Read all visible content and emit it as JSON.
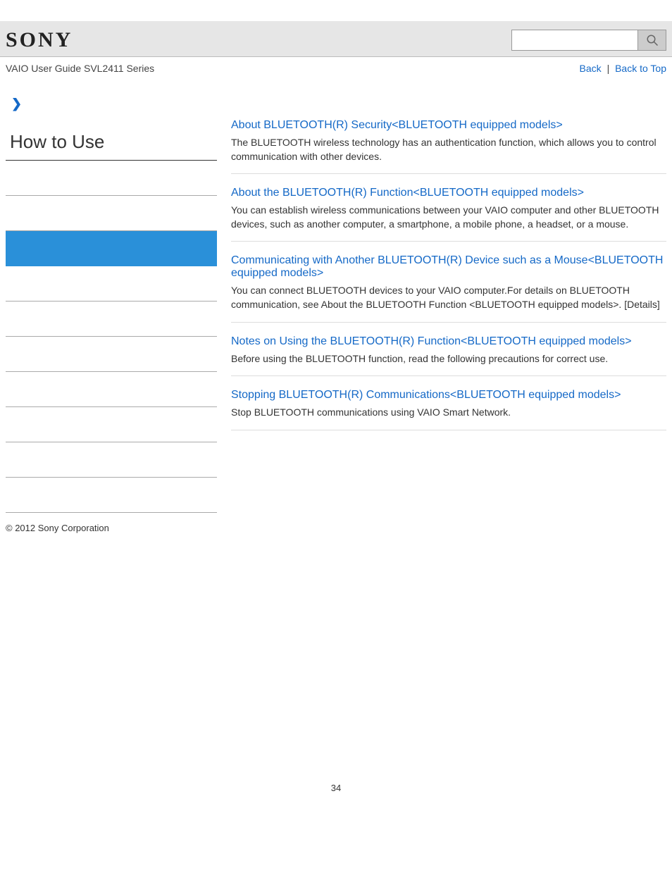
{
  "header": {
    "logo": "SONY",
    "search": {
      "value": "",
      "placeholder": ""
    }
  },
  "subheader": {
    "guide": "VAIO User Guide SVL2411 Series",
    "back": "Back",
    "back_to_top": "Back to Top"
  },
  "sidebar": {
    "title": "How to Use",
    "items": [
      {
        "active": false
      },
      {
        "active": false
      },
      {
        "active": true
      },
      {
        "active": false
      },
      {
        "active": false
      },
      {
        "active": false
      },
      {
        "active": false
      },
      {
        "active": false
      },
      {
        "active": false
      },
      {
        "active": false
      }
    ]
  },
  "articles": [
    {
      "title": "About BLUETOOTH(R) Security<BLUETOOTH equipped models>",
      "body": "The BLUETOOTH wireless technology has an authentication function, which allows you to control communication with other devices."
    },
    {
      "title": "About the BLUETOOTH(R) Function<BLUETOOTH equipped models>",
      "body": "You can establish wireless communications between your VAIO computer and other BLUETOOTH devices, such as another computer, a smartphone, a mobile phone, a headset, or a mouse."
    },
    {
      "title": "Communicating with Another BLUETOOTH(R) Device such as a Mouse<BLUETOOTH equipped models>",
      "body": "You can connect BLUETOOTH devices to your VAIO computer.For details on BLUETOOTH communication, see About the BLUETOOTH Function <BLUETOOTH equipped models>. [Details]"
    },
    {
      "title": "Notes on Using the BLUETOOTH(R) Function<BLUETOOTH equipped models>",
      "body": "Before using the BLUETOOTH function, read the following precautions for correct use."
    },
    {
      "title": "Stopping BLUETOOTH(R) Communications<BLUETOOTH equipped models>",
      "body": "Stop BLUETOOTH communications using VAIO Smart Network."
    }
  ],
  "footer": {
    "copyright": "© 2012 Sony Corporation"
  },
  "page_number": "34"
}
